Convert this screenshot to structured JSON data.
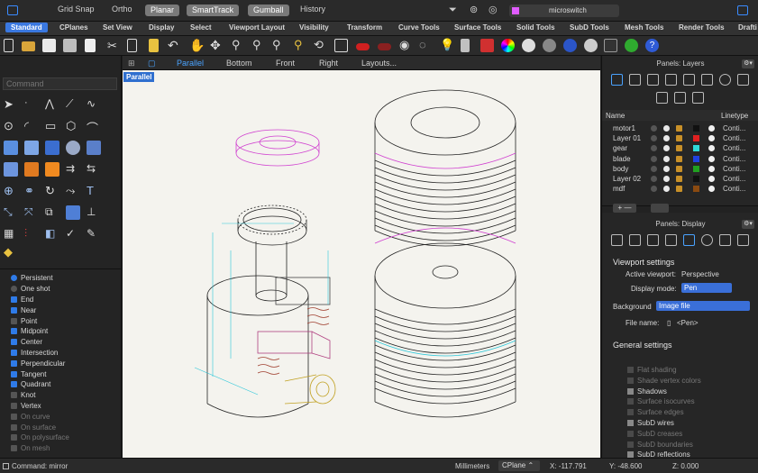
{
  "topbar": {
    "items": [
      "Grid Snap",
      "Ortho",
      "Planar",
      "SmartTrack",
      "Gumball",
      "History"
    ],
    "document_name": "microswitch"
  },
  "tabs": [
    "Standard",
    "CPlanes",
    "Set View",
    "Display",
    "Select",
    "Viewport Layout",
    "Visibility",
    "Transform",
    "Curve Tools",
    "Surface Tools",
    "Solid Tools",
    "SubD Tools",
    "Mesh Tools",
    "Render Tools",
    "Drafti"
  ],
  "command": {
    "placeholder": "Command",
    "last": "Command: mirror"
  },
  "viewport_tabs": [
    "Parallel",
    "Bottom",
    "Front",
    "Right",
    "Layouts..."
  ],
  "viewport": {
    "label": "Parallel"
  },
  "osnaps": {
    "mode_persistent": "Persistent",
    "mode_oneshot": "One shot",
    "items": [
      {
        "label": "End",
        "on": true
      },
      {
        "label": "Near",
        "on": true
      },
      {
        "label": "Point",
        "on": false
      },
      {
        "label": "Midpoint",
        "on": true
      },
      {
        "label": "Center",
        "on": true
      },
      {
        "label": "Intersection",
        "on": true
      },
      {
        "label": "Perpendicular",
        "on": true
      },
      {
        "label": "Tangent",
        "on": true
      },
      {
        "label": "Quadrant",
        "on": true
      },
      {
        "label": "Knot",
        "on": false
      },
      {
        "label": "Vertex",
        "on": false
      },
      {
        "label": "On curve",
        "on": false
      },
      {
        "label": "On surface",
        "on": false
      },
      {
        "label": "On polysurface",
        "on": false
      },
      {
        "label": "On mesh",
        "on": false
      }
    ]
  },
  "layers_panel": {
    "title": "Panels: Layers",
    "col_name": "Name",
    "col_linetype": "Linetype",
    "rows": [
      {
        "name": "motor1",
        "color": "#111111",
        "linetype": "Conti..."
      },
      {
        "name": "Layer 01",
        "color": "#e02020",
        "linetype": "Conti..."
      },
      {
        "name": "gear",
        "color": "#2fd9d9",
        "linetype": "Conti..."
      },
      {
        "name": "blade",
        "color": "#2040e0",
        "linetype": "Conti..."
      },
      {
        "name": "body",
        "color": "#20a020",
        "linetype": "Conti..."
      },
      {
        "name": "Layer 02",
        "color": "#111111",
        "linetype": "Conti..."
      },
      {
        "name": "mdf",
        "color": "#8a4a10",
        "linetype": "Conti..."
      }
    ]
  },
  "display_panel": {
    "title": "Panels: Display",
    "viewport_settings": "Viewport settings",
    "active_viewport_label": "Active viewport:",
    "active_viewport": "Perspective",
    "display_mode_label": "Display mode:",
    "display_mode": "Pen",
    "background_label": "Background",
    "background": "Image file",
    "file_name_label": "File name:",
    "file_name": "<Pen>",
    "general_settings": "General settings",
    "general": [
      {
        "label": "Flat shading",
        "on": false
      },
      {
        "label": "Shade vertex colors",
        "on": false
      },
      {
        "label": "Shadows",
        "on": true
      },
      {
        "label": "Surface isocurves",
        "on": false
      },
      {
        "label": "Surface edges",
        "on": false
      },
      {
        "label": "SubD wires",
        "on": true
      },
      {
        "label": "SubD creases",
        "on": false
      },
      {
        "label": "SubD boundaries",
        "on": false
      },
      {
        "label": "SubD reflections",
        "on": true
      }
    ]
  },
  "status": {
    "units": "Millimeters",
    "cplane": "CPlane",
    "x": "X: -117.791",
    "y": "Y: -48.600",
    "z": "Z: 0.000"
  }
}
